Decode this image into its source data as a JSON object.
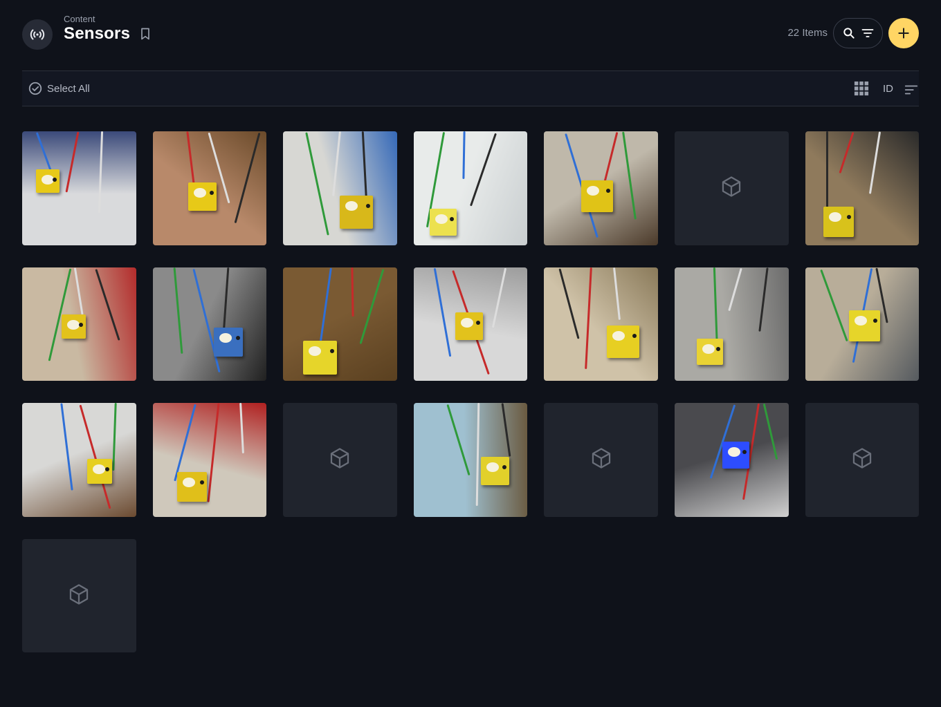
{
  "header": {
    "breadcrumb": "Content",
    "title": "Sensors",
    "item_count": "22 Items",
    "module_icon": "sensor-broadcast-icon",
    "bookmark_icon": "bookmark-icon",
    "search_icon": "search-icon",
    "filter_icon": "filter-icon",
    "add_icon": "plus-icon"
  },
  "toolbar": {
    "select_all_label": "Select All",
    "view_icon": "grid-view-icon",
    "sort_field": "ID",
    "sort_icon": "sort-icon"
  },
  "colors": {
    "background": "#0f121a",
    "accent": "#ffd564",
    "card_placeholder": "#20242d",
    "sensor_yellow": "#e7c918"
  },
  "grid": {
    "items": [
      {
        "type": "photo",
        "scene": "contactor-panel-white",
        "colors": [
          "#d9dadc",
          "#3b4a7a",
          "#e7c918"
        ]
      },
      {
        "type": "photo",
        "scene": "meter-wooden-desk",
        "colors": [
          "#b8896a",
          "#6a4a2a",
          "#e7c918"
        ]
      },
      {
        "type": "photo",
        "scene": "white-wall-blue-wire",
        "colors": [
          "#d7d7d3",
          "#3569b8",
          "#d8b81a"
        ]
      },
      {
        "type": "photo",
        "scene": "whatsapp-box-white",
        "colors": [
          "#e8ebea",
          "#c9ced0",
          "#ece14e"
        ]
      },
      {
        "type": "photo",
        "scene": "wall-box-wires",
        "colors": [
          "#bfb8aa",
          "#4b3a2a",
          "#e0c317"
        ]
      },
      {
        "type": "placeholder",
        "icon": "cube-icon"
      },
      {
        "type": "photo",
        "scene": "cabinet-red-lamp",
        "colors": [
          "#8f7a5c",
          "#2a2a2a",
          "#d8c21b"
        ]
      },
      {
        "type": "photo",
        "scene": "distribution-box-red-wires",
        "colors": [
          "#c9b9a2",
          "#b32b2b",
          "#e2c21c"
        ]
      },
      {
        "type": "photo",
        "scene": "desk-circuit-board",
        "colors": [
          "#8a8a8a",
          "#202020",
          "#3a6fbf"
        ]
      },
      {
        "type": "photo",
        "scene": "brown-wall-hanging",
        "colors": [
          "#7a5a33",
          "#5a4020",
          "#e6d52a"
        ]
      },
      {
        "type": "photo",
        "scene": "breakers-row",
        "colors": [
          "#d8d8d8",
          "#9c9c9c",
          "#e2c21c"
        ]
      },
      {
        "type": "photo",
        "scene": "hand-holding-sensor",
        "colors": [
          "#cfc2a8",
          "#8a7a5a",
          "#e7cf22"
        ]
      },
      {
        "type": "photo",
        "scene": "socket-barcode",
        "colors": [
          "#aaa9a4",
          "#6c6c6c",
          "#e9d233"
        ]
      },
      {
        "type": "photo",
        "scene": "whatsapp-notifier-wall",
        "colors": [
          "#b8ad99",
          "#555a5f",
          "#e6d52a"
        ]
      },
      {
        "type": "photo",
        "scene": "rusty-shelf",
        "colors": [
          "#d8d8d6",
          "#6b4a30",
          "#e6cf20"
        ]
      },
      {
        "type": "photo",
        "scene": "terminal-block-red-black",
        "colors": [
          "#cfc8bb",
          "#b02020",
          "#e0bf1a"
        ]
      },
      {
        "type": "placeholder",
        "icon": "cube-icon"
      },
      {
        "type": "photo",
        "scene": "tiles-cables",
        "colors": [
          "#9fc0d0",
          "#6a5a40",
          "#e2d02a"
        ]
      },
      {
        "type": "placeholder",
        "icon": "cube-icon"
      },
      {
        "type": "photo",
        "scene": "meter-blue-light",
        "colors": [
          "#4a4a4e",
          "#d0d0d0",
          "#2d4dff"
        ]
      },
      {
        "type": "placeholder",
        "icon": "cube-icon"
      },
      {
        "type": "placeholder",
        "icon": "cube-icon"
      }
    ]
  }
}
